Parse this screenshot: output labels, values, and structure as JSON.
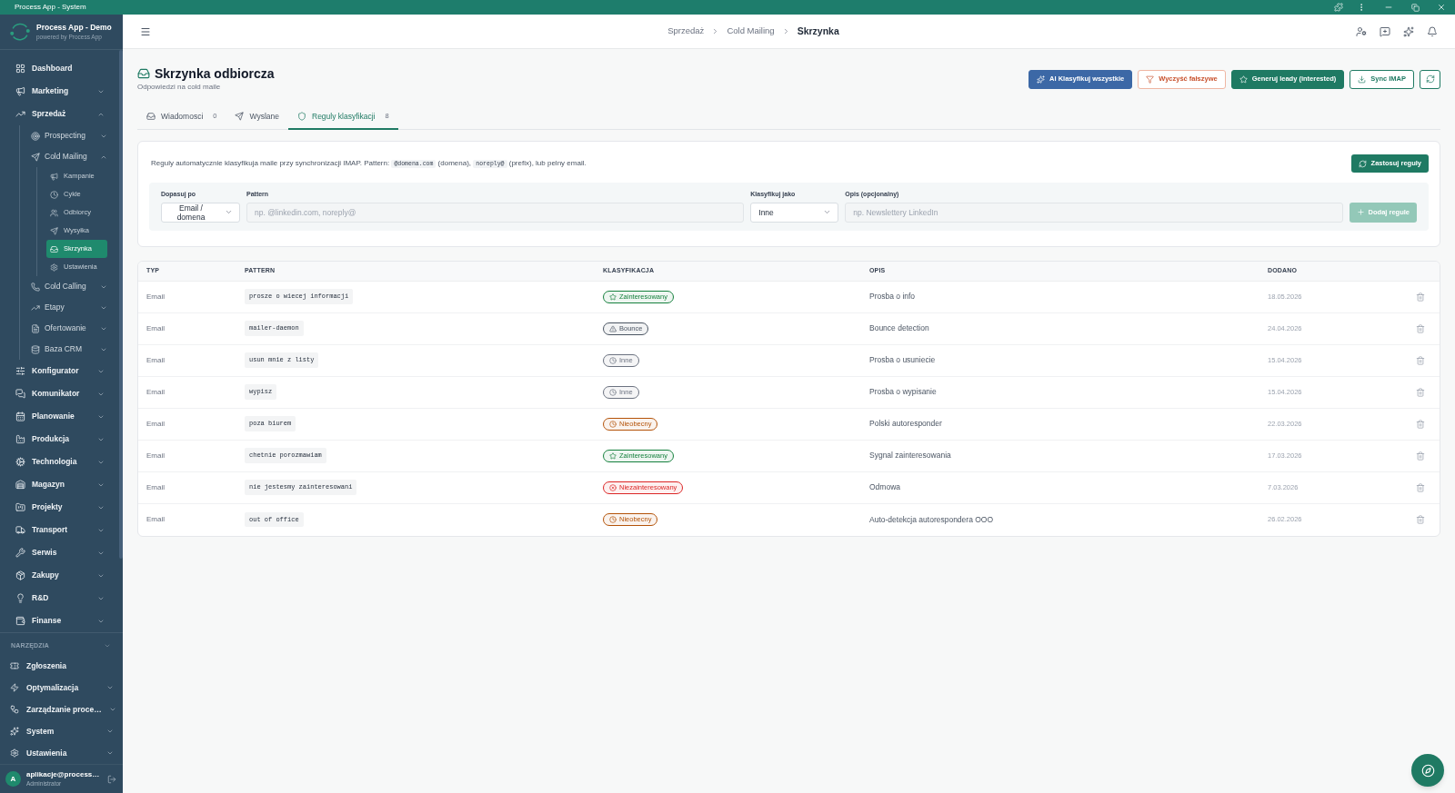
{
  "window": {
    "title": "Process App - System"
  },
  "sidebar": {
    "brand": {
      "name": "Process App - Demo",
      "tagline": "powered by Process App"
    },
    "items": [
      {
        "label": "Dashboard",
        "kind": "link",
        "selected": false
      },
      {
        "label": "Marketing",
        "kind": "group",
        "expanded": false,
        "selected": false
      },
      {
        "label": "Sprzedaż",
        "kind": "group",
        "expanded": true,
        "selected": false,
        "children": [
          {
            "label": "Prospecting",
            "kind": "group",
            "expanded": false,
            "selected": false
          },
          {
            "label": "Cold Mailing",
            "kind": "group",
            "expanded": true,
            "selected": false,
            "children": [
              {
                "label": "Kampanie",
                "kind": "link",
                "selected": false
              },
              {
                "label": "Cykle",
                "kind": "link",
                "selected": false
              },
              {
                "label": "Odbiorcy",
                "kind": "link",
                "selected": false
              },
              {
                "label": "Wysyłka",
                "kind": "link",
                "selected": false
              },
              {
                "label": "Skrzynka",
                "kind": "link",
                "selected": true
              },
              {
                "label": "Ustawienia",
                "kind": "link",
                "selected": false
              }
            ]
          },
          {
            "label": "Cold Calling",
            "kind": "group",
            "expanded": false,
            "selected": false
          },
          {
            "label": "Etapy",
            "kind": "group",
            "expanded": false,
            "selected": false
          },
          {
            "label": "Ofertowanie",
            "kind": "group",
            "expanded": false,
            "selected": false
          },
          {
            "label": "Baza CRM",
            "kind": "group",
            "expanded": false,
            "selected": false
          }
        ]
      },
      {
        "label": "Konfigurator",
        "kind": "group",
        "expanded": false,
        "selected": false
      },
      {
        "label": "Komunikator",
        "kind": "group",
        "expanded": false,
        "selected": false
      },
      {
        "label": "Planowanie",
        "kind": "group",
        "expanded": false,
        "selected": false
      },
      {
        "label": "Produkcja",
        "kind": "group",
        "expanded": false,
        "selected": false
      },
      {
        "label": "Technologia",
        "kind": "group",
        "expanded": false,
        "selected": false
      },
      {
        "label": "Magazyn",
        "kind": "group",
        "expanded": false,
        "selected": false
      },
      {
        "label": "Projekty",
        "kind": "group",
        "expanded": false,
        "selected": false
      },
      {
        "label": "Transport",
        "kind": "group",
        "expanded": false,
        "selected": false
      },
      {
        "label": "Serwis",
        "kind": "group",
        "expanded": false,
        "selected": false
      },
      {
        "label": "Zakupy",
        "kind": "group",
        "expanded": false,
        "selected": false
      },
      {
        "label": "R&D",
        "kind": "group",
        "expanded": false,
        "selected": false
      },
      {
        "label": "Finanse",
        "kind": "group",
        "expanded": false,
        "selected": false
      }
    ],
    "tools": {
      "title": "NARZĘDZIA",
      "items": [
        {
          "label": "Zgłoszenia",
          "kind": "link",
          "selected": false
        },
        {
          "label": "Optymalizacja",
          "kind": "group",
          "expanded": false,
          "selected": false
        },
        {
          "label": "Zarządzanie proce…",
          "kind": "group",
          "expanded": false,
          "selected": false
        },
        {
          "label": "System",
          "kind": "group",
          "expanded": false,
          "selected": false
        },
        {
          "label": "Ustawienia",
          "kind": "group",
          "expanded": false,
          "selected": false
        }
      ]
    },
    "user": {
      "initial": "A",
      "name": "aplikacje@process…",
      "role": "Administrator"
    }
  },
  "header": {
    "breadcrumb": [
      {
        "label": "Sprzedaż",
        "current": false
      },
      {
        "label": "Cold Mailing",
        "current": false
      },
      {
        "label": "Skrzynka",
        "current": true
      }
    ]
  },
  "page": {
    "title": "Skrzynka odbiorcza",
    "subtitle": "Odpowiedzi na cold maile",
    "actions": [
      {
        "label": "AI Klasyfikuj wszystkie",
        "kind": "ai"
      },
      {
        "label": "Wyczyść fałszywe",
        "kind": "danger"
      },
      {
        "label": "Generuj leady (interested)",
        "kind": "solid"
      },
      {
        "label": "Sync IMAP",
        "kind": "outline"
      }
    ],
    "tabs": [
      {
        "label": "Wiadomosci",
        "count": "0",
        "selected": false
      },
      {
        "label": "Wyslane",
        "selected": false
      },
      {
        "label": "Reguly klasyfikacji",
        "count": "8",
        "selected": true
      }
    ],
    "rules": {
      "description": [
        {
          "kind": "text",
          "text": "Reguly automatycznie klasyfikuja maile przy synchronizacji IMAP. Pattern:"
        },
        {
          "kind": "code",
          "text": "@domena.com"
        },
        {
          "kind": "text",
          "text": "(domena),"
        },
        {
          "kind": "code",
          "text": "noreply@"
        },
        {
          "kind": "text",
          "text": "(prefix), lub pelny email."
        }
      ],
      "apply_button": "Zastosuj reguly",
      "form": {
        "fields": [
          {
            "label": "Dopasuj po",
            "kind": "select",
            "value": "Email / domena"
          },
          {
            "label": "Pattern",
            "kind": "input",
            "placeholder": "np. @linkedin.com, noreply@"
          },
          {
            "label": "Klasyfikuj jako",
            "kind": "select",
            "value": "Inne"
          },
          {
            "label": "Opis (opcjonalny)",
            "kind": "input",
            "placeholder": "np. Newslettery LinkedIn"
          }
        ],
        "add_button": {
          "label": "Dodaj regule",
          "disabled": true
        }
      }
    },
    "table": {
      "columns": [
        "TYP",
        "PATTERN",
        "KLASYFIKACJA",
        "OPIS",
        "DODANO"
      ],
      "rows": [
        {
          "type": "Email",
          "pattern": "prosze o wiecej informacji",
          "classification": {
            "label": "Zainteresowany",
            "kind": "interested",
            "color": "#15803d"
          },
          "description": "Prosba o info",
          "added": "18.05.2026"
        },
        {
          "type": "Email",
          "pattern": "mailer-daemon",
          "classification": {
            "label": "Bounce",
            "kind": "bounce",
            "color": "#4b5563"
          },
          "description": "Bounce detection",
          "added": "24.04.2026"
        },
        {
          "type": "Email",
          "pattern": "usun mnie z listy",
          "classification": {
            "label": "Inne",
            "kind": "other",
            "color": "#6b7280"
          },
          "description": "Prosba o usuniecie",
          "added": "15.04.2026"
        },
        {
          "type": "Email",
          "pattern": "wypisz",
          "classification": {
            "label": "Inne",
            "kind": "other",
            "color": "#6b7280"
          },
          "description": "Prosba o wypisanie",
          "added": "15.04.2026"
        },
        {
          "type": "Email",
          "pattern": "poza biurem",
          "classification": {
            "label": "Nieobecny",
            "kind": "away",
            "color": "#b45309"
          },
          "description": "Polski autoresponder",
          "added": "22.03.2026"
        },
        {
          "type": "Email",
          "pattern": "chetnie porozmawiam",
          "classification": {
            "label": "Zainteresowany",
            "kind": "interested",
            "color": "#15803d"
          },
          "description": "Sygnal zainteresowania",
          "added": "17.03.2026"
        },
        {
          "type": "Email",
          "pattern": "nie jestesmy zainteresowani",
          "classification": {
            "label": "Niezainteresowany",
            "kind": "rejected",
            "color": "#dc2626"
          },
          "description": "Odmowa",
          "added": "7.03.2026"
        },
        {
          "type": "Email",
          "pattern": "out of office",
          "classification": {
            "label": "Nieobecny",
            "kind": "away",
            "color": "#b45309"
          },
          "description": "Auto-detekcja autorespondera OOO",
          "added": "26.02.2026"
        }
      ]
    }
  }
}
